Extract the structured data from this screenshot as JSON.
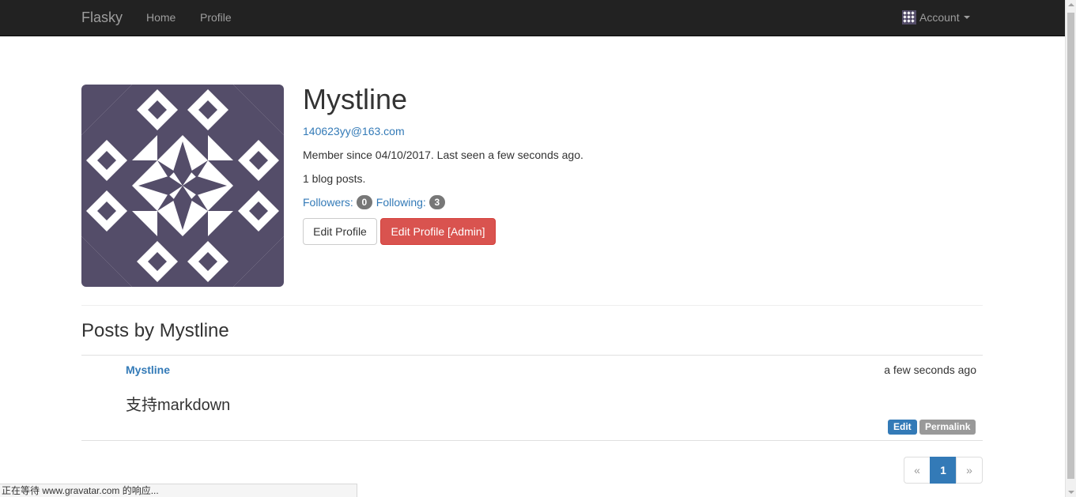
{
  "navbar": {
    "brand": "Flasky",
    "links": [
      "Home",
      "Profile"
    ],
    "account_label": "Account",
    "account_icon": "identicon-avatar",
    "caret_icon": "caret-down-icon"
  },
  "profile": {
    "name": "Mystline",
    "email": "140623yy@163.com",
    "member_info": "Member since 04/10/2017. Last seen a few seconds ago.",
    "blog_posts": "1 blog posts.",
    "followers_label": "Followers:",
    "followers_count": "0",
    "following_label": "Following:",
    "following_count": "3",
    "edit_profile_label": "Edit Profile",
    "edit_admin_label": "Edit Profile [Admin]",
    "avatar_icon": "identicon-avatar",
    "avatar_color": "#544d69"
  },
  "posts": {
    "title": "Posts by Mystline",
    "items": [
      {
        "author": "Mystline",
        "date": "a few seconds ago",
        "body": "支持markdown",
        "edit_label": "Edit",
        "permalink_label": "Permalink"
      }
    ]
  },
  "pagination": {
    "prev": "«",
    "current": "1",
    "next": "»"
  },
  "status_bar": {
    "text": "正在等待 www.gravatar.com 的响应..."
  },
  "colors": {
    "navbar_bg": "#222222",
    "link": "#337ab7",
    "danger": "#d9534f",
    "badge": "#777777"
  }
}
